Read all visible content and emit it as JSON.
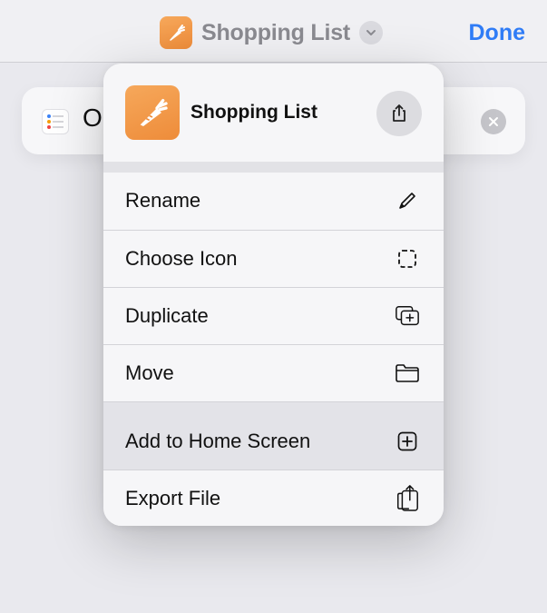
{
  "topbar": {
    "title": "Shopping List",
    "done_label": "Done",
    "app_icon": "carrot-icon",
    "chevron_icon": "chevron-down-icon"
  },
  "background": {
    "card_partial_text": "O",
    "list_icon": "list-icon",
    "clear_icon": "clear-icon"
  },
  "menu": {
    "header": {
      "title": "Shopping List",
      "icon": "carrot-icon",
      "share_icon": "share-icon"
    },
    "items": [
      {
        "label": "Rename",
        "icon": "pencil-icon"
      },
      {
        "label": "Choose Icon",
        "icon": "dashed-square-icon"
      },
      {
        "label": "Duplicate",
        "icon": "duplicate-icon"
      },
      {
        "label": "Move",
        "icon": "folder-icon"
      },
      {
        "label": "Add to Home Screen",
        "icon": "plus-square-icon"
      },
      {
        "label": "Export File",
        "icon": "export-icon"
      }
    ]
  },
  "colors": {
    "accent": "#2f7cf6",
    "app_icon_orange": "#ee8c3a",
    "highlight_row": "#e3e3e8"
  }
}
